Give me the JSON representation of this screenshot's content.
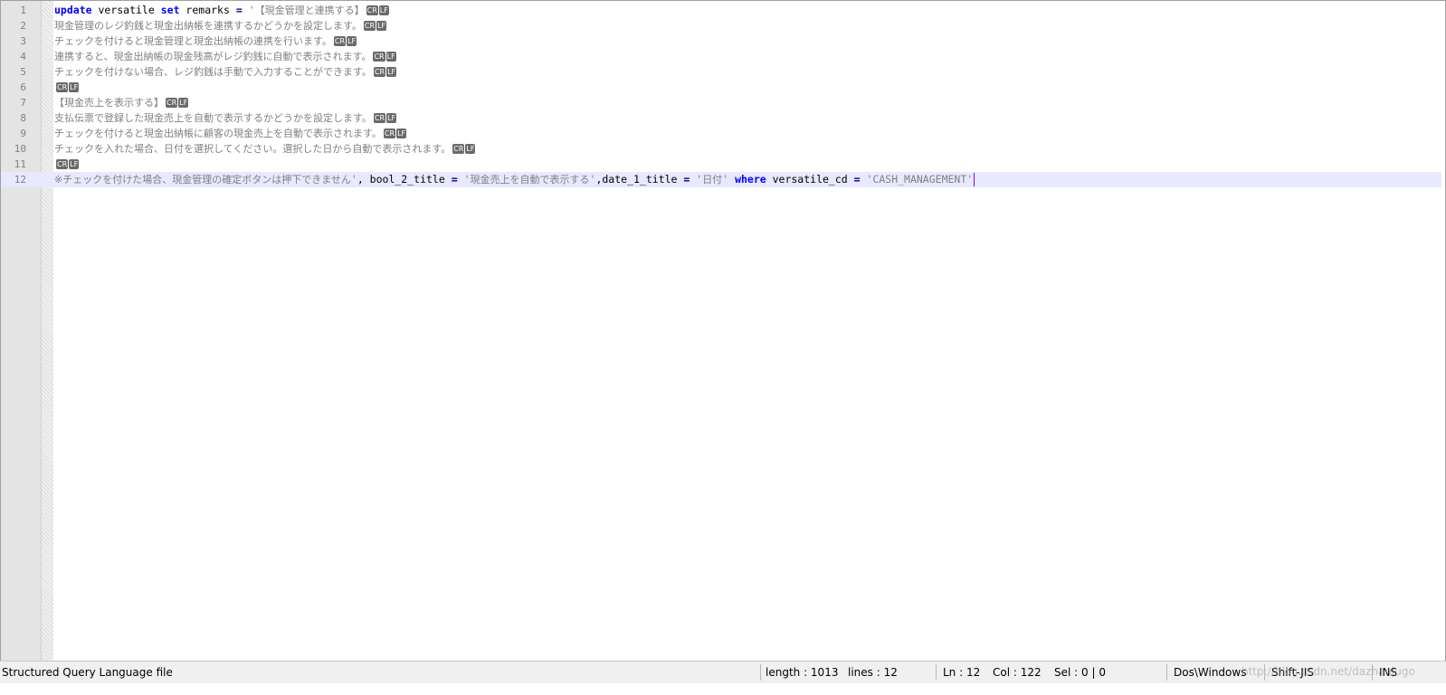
{
  "editor": {
    "lines": [
      {
        "num": "1",
        "segments": [
          {
            "cls": "kw",
            "t": "update"
          },
          {
            "cls": "ident",
            "t": " versatile "
          },
          {
            "cls": "kw",
            "t": "set"
          },
          {
            "cls": "ident",
            "t": " remarks "
          },
          {
            "cls": "op",
            "t": "="
          },
          {
            "cls": "ident",
            "t": " "
          },
          {
            "cls": "str",
            "t": "'"
          },
          {
            "cls": "jp",
            "t": "【現金管理と連携する】"
          }
        ],
        "eol": true
      },
      {
        "num": "2",
        "segments": [
          {
            "cls": "jp",
            "t": "現金管理のレジ釣銭と現金出納帳を連携するかどうかを設定します。"
          }
        ],
        "eol": true
      },
      {
        "num": "3",
        "segments": [
          {
            "cls": "jp",
            "t": "チェックを付けると現金管理と現金出納帳の連携を行います。"
          }
        ],
        "eol": true
      },
      {
        "num": "4",
        "segments": [
          {
            "cls": "jp",
            "t": "連携すると、現金出納帳の現金残高がレジ釣銭に自動で表示されます。"
          }
        ],
        "eol": true
      },
      {
        "num": "5",
        "segments": [
          {
            "cls": "jp",
            "t": "チェックを付けない場合、レジ釣銭は手動で入力することができます。"
          }
        ],
        "eol": true
      },
      {
        "num": "6",
        "segments": [],
        "eol": true
      },
      {
        "num": "7",
        "segments": [
          {
            "cls": "jp",
            "t": "【現金売上を表示する】"
          }
        ],
        "eol": true
      },
      {
        "num": "8",
        "segments": [
          {
            "cls": "jp",
            "t": "支払伝票で登録した現金売上を自動で表示するかどうかを設定します。"
          }
        ],
        "eol": true
      },
      {
        "num": "9",
        "segments": [
          {
            "cls": "jp",
            "t": "チェックを付けると現金出納帳に顧客の現金売上を自動で表示されます。"
          }
        ],
        "eol": true
      },
      {
        "num": "10",
        "segments": [
          {
            "cls": "jp",
            "t": "チェックを入れた場合、日付を選択してください。選択した日から自動で表示されます。"
          }
        ],
        "eol": true
      },
      {
        "num": "11",
        "segments": [],
        "eol": true
      },
      {
        "num": "12",
        "current": true,
        "segments": [
          {
            "cls": "jp",
            "t": "※チェックを付けた場合、現金管理の確定ボタンは押下できません"
          },
          {
            "cls": "str",
            "t": "'"
          },
          {
            "cls": "ident",
            "t": ", bool_2_title "
          },
          {
            "cls": "op",
            "t": "="
          },
          {
            "cls": "ident",
            "t": " "
          },
          {
            "cls": "str",
            "t": "'"
          },
          {
            "cls": "jp",
            "t": "現金売上を自動で表示する"
          },
          {
            "cls": "str",
            "t": "'"
          },
          {
            "cls": "ident",
            "t": ",date_1_title "
          },
          {
            "cls": "op",
            "t": "="
          },
          {
            "cls": "ident",
            "t": " "
          },
          {
            "cls": "str",
            "t": "'"
          },
          {
            "cls": "jp",
            "t": "日付"
          },
          {
            "cls": "str",
            "t": "'"
          },
          {
            "cls": "ident",
            "t": " "
          },
          {
            "cls": "kw",
            "t": "where"
          },
          {
            "cls": "ident",
            "t": " versatile_cd "
          },
          {
            "cls": "op",
            "t": "="
          },
          {
            "cls": "ident",
            "t": " "
          },
          {
            "cls": "str",
            "t": "'CASH_MANAGEMENT'"
          }
        ],
        "eol": false,
        "caret": true
      }
    ],
    "eol_cr": "CR",
    "eol_lf": "LF"
  },
  "statusbar": {
    "file_type": "Structured Query Language file",
    "length": "length : 1013",
    "lines": "lines : 12",
    "ln": "Ln : 12",
    "col": "Col : 122",
    "sel": "Sel : 0 | 0",
    "eol_format": "Dos\\Windows",
    "encoding": "Shift-JIS",
    "mode": "INS",
    "watermark": "http://blog.csdn.net/dazhanjugo"
  }
}
